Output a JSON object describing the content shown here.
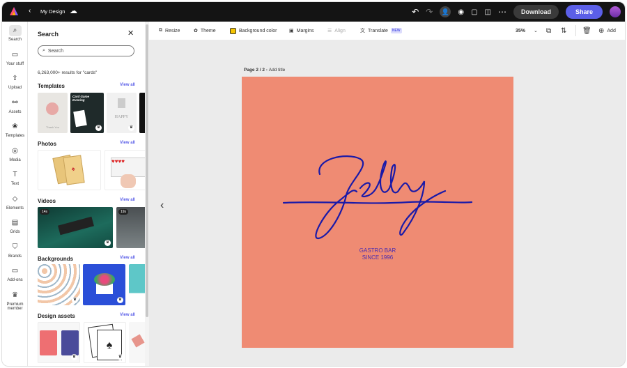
{
  "topbar": {
    "title": "My Design",
    "download": "Download",
    "share": "Share"
  },
  "rail": [
    {
      "label": "Search",
      "icon": "search-icon",
      "glyph": "⌕"
    },
    {
      "label": "Your stuff",
      "icon": "folder-icon",
      "glyph": "▭"
    },
    {
      "label": "Upload",
      "icon": "upload-icon",
      "glyph": "⇪"
    },
    {
      "label": "Assets",
      "icon": "assets-icon",
      "glyph": "⚯"
    },
    {
      "label": "Templates",
      "icon": "templates-icon",
      "glyph": "❀"
    },
    {
      "label": "Media",
      "icon": "media-icon",
      "glyph": "◎"
    },
    {
      "label": "Text",
      "icon": "text-icon",
      "glyph": "T"
    },
    {
      "label": "Elements",
      "icon": "elements-icon",
      "glyph": "◇"
    },
    {
      "label": "Grids",
      "icon": "grids-icon",
      "glyph": "▤"
    },
    {
      "label": "Brands",
      "icon": "brands-icon",
      "glyph": "⛉"
    },
    {
      "label": "Add-ons",
      "icon": "addons-icon",
      "glyph": "▭"
    },
    {
      "label": "Premium member",
      "icon": "crown-icon",
      "glyph": "♛"
    }
  ],
  "panel": {
    "title": "Search",
    "search_placeholder": "Search",
    "results": "6,263,000+ results for \"cards\"",
    "view_all": "View all",
    "sections": {
      "templates": "Templates",
      "photos": "Photos",
      "videos": "Videos",
      "backgrounds": "Backgrounds",
      "design_assets": "Design assets"
    },
    "template_texts": [
      "Thank You",
      "Card Game Evening",
      "HAPPY"
    ],
    "video_durations": [
      "14s",
      "19s"
    ]
  },
  "toolbar": {
    "resize": "Resize",
    "theme": "Theme",
    "background_color": "Background color",
    "margins": "Margins",
    "align": "Align",
    "translate": "Translate",
    "new_badge": "NEW",
    "zoom": "35%",
    "add": "Add"
  },
  "canvas": {
    "page_label": "Page 2 / 2 - ",
    "add_title": "Add title",
    "logo_text": "Jelly",
    "tagline1": "GASTRO BAR",
    "tagline2": "SINCE 1996",
    "bg_color": "#ef8b73",
    "ink_color": "#1a1aa8"
  }
}
